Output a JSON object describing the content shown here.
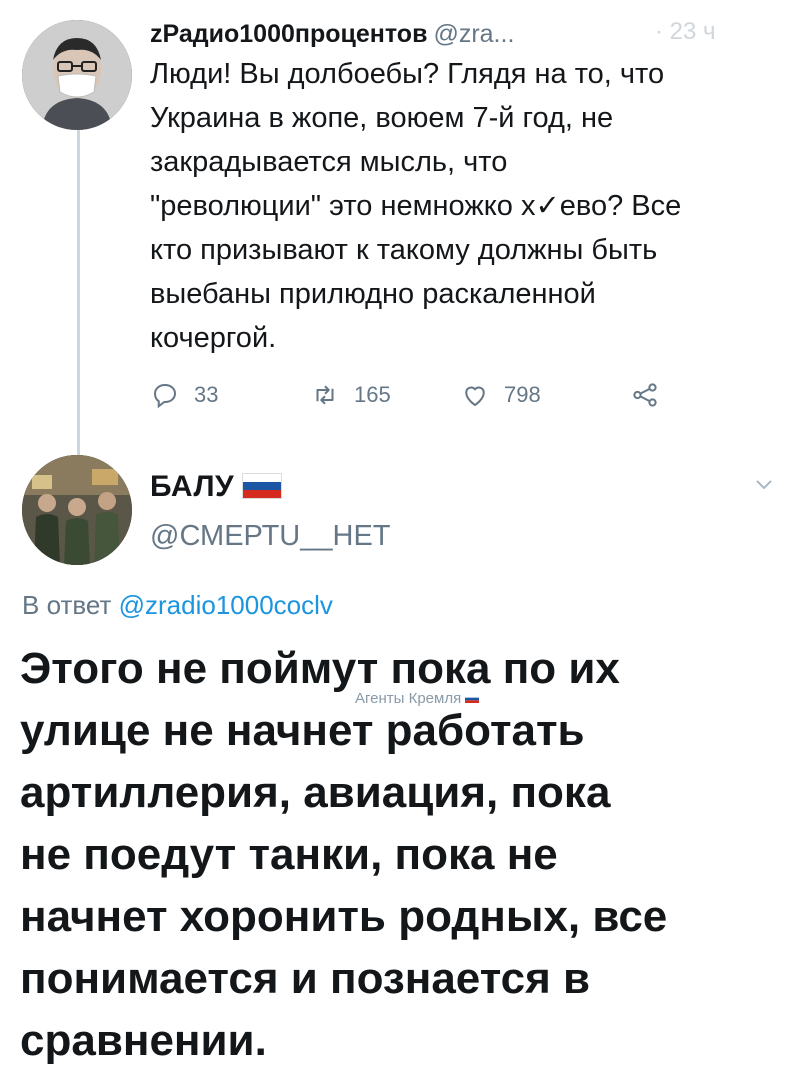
{
  "tweet1": {
    "display_name": "zРадио1000процентов",
    "handle": "@zra...",
    "faint_text": "· 23 ч",
    "body": "Люди! Вы долбоебы? Глядя на то, что\nУкраина в жопе, воюем 7-й год, не\nзакрадывается мысль, что\n\"революции\" это немножко х✓ево? Все\nкто призывают к такому должны быть\nвыебаны прилюдно раскаленной\nкочергой.",
    "actions": {
      "replies": "33",
      "retweets": "165",
      "likes": "798",
      "icons": [
        "reply-icon",
        "retweet-icon",
        "like-icon",
        "share-icon"
      ]
    }
  },
  "tweet2": {
    "display_name": "БАЛУ",
    "handle": "@СМЕРТU__НЕТ",
    "replying_prefix": "В ответ",
    "replying_to": "@zradio1000coclv",
    "body": "Этого не поймут пока по их\nулице не начнет работать\nартиллерия, авиация, пока\nне поедут танки, пока не\nначнет хоронить родных,  все\nпонимается и познается в\nсравнении."
  },
  "watermark": {
    "text": "Агенты Кремля"
  },
  "colors": {
    "text": "#14171a",
    "secondary": "#657786",
    "link": "#1b95e0",
    "thread_line": "#ccd6dd"
  }
}
